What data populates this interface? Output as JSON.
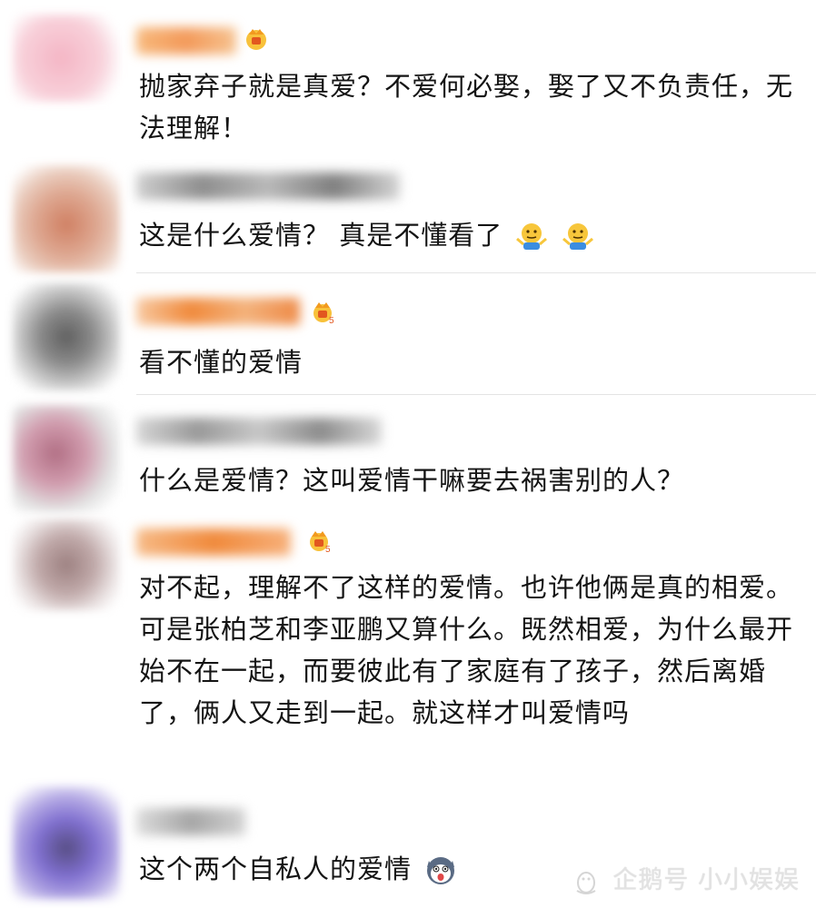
{
  "comments": [
    {
      "text": "抛家弃子就是真爱？不爱何必娶，娶了又不负责任，无法理解！",
      "badge": "vip-crown-icon"
    },
    {
      "text": "这是什么爱情？ 真是不懂看了",
      "emojis": [
        "shrug-emoji-icon",
        "shrug-emoji-icon"
      ]
    },
    {
      "text": "看不懂的爱情",
      "badge": "vip-crown-5-icon"
    },
    {
      "text": "什么是爱情？这叫爱情干嘛要去祸害别的人？"
    },
    {
      "text": "对不起，理解不了这样的爱情。也许他俩是真的相爱。可是张柏芝和李亚鹏又算什么。既然相爱，为什么最开始不在一起，而要彼此有了家庭有了孩子，然后离婚了，俩人又走到一起。就这样才叫爱情吗",
      "badge": "vip-crown-5-icon"
    },
    {
      "text": "这个两个自私人的爱情",
      "emojis": [
        "husky-emoji-icon"
      ]
    }
  ],
  "watermark": {
    "text": "企鹅号 小小娱娱"
  },
  "colors": {
    "orange_name": "#f08a3c",
    "gray_name": "#9a9a9a",
    "badge": "#f5a623"
  }
}
